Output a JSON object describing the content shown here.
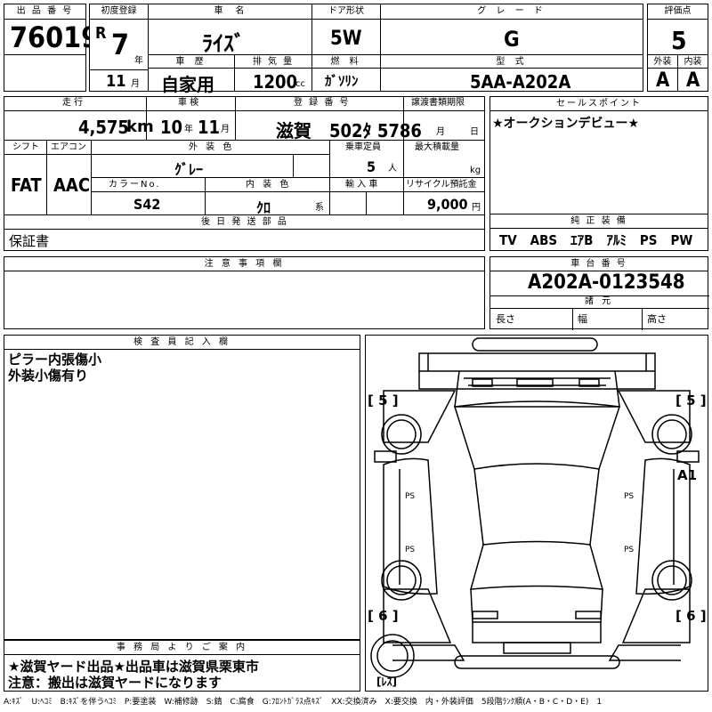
{
  "header": {
    "lot_label": "出 品 番 号",
    "lot": "76019",
    "first_reg_label": "初度登録",
    "era": "R",
    "year": "7",
    "year_unit": "年",
    "month": "11",
    "month_unit": "月",
    "name_label": "車　名",
    "name": "ﾗｲｽﾞ",
    "door_label": "ドア形状",
    "door": "5W",
    "grade_label": "グ レ ー ド",
    "grade": "G",
    "score_label": "評価点",
    "score": "5",
    "history_label": "車 歴",
    "history": "自家用",
    "displacement_label": "排 気 量",
    "displacement": "1200",
    "displacement_unit": "cc",
    "fuel_label": "燃 料",
    "fuel": "ｶﾞｿﾘﾝ",
    "model_label": "型 式",
    "model": "5AA-A202A",
    "ext_label": "外装",
    "ext": "A",
    "int_label": "内装",
    "int": "A"
  },
  "row2": {
    "mileage_label": "走 行",
    "mileage": "4,575",
    "mileage_unit": "km",
    "inspection_label": "車 検",
    "insp_year": "10",
    "insp_year_unit": "年",
    "insp_month": "11",
    "insp_month_unit": "月",
    "reg_no_label": "登 録 番 号",
    "reg_no": "滋賀　502ﾀ 5786",
    "transfer_label": "譲渡書類期限",
    "transfer_month_unit": "月",
    "transfer_day_unit": "日",
    "sales_label": "セールスポイント",
    "sales": "★オークションデビュー★"
  },
  "row3": {
    "shift_label": "シフト",
    "shift": "FAT",
    "ac_label": "エアコン",
    "ac": "AAC",
    "color_label": "外 装 色",
    "color": "ｸﾞﾚｰ",
    "capacity_label": "乗車定員",
    "capacity": "5",
    "capacity_unit": "人",
    "load_label": "最大積載量",
    "load_unit": "kg",
    "color_no_label": "カラーNo.",
    "color_no": "S42",
    "int_color_label": "内 装 色",
    "int_color": "ｸﾛ",
    "int_color_unit": "系",
    "import_label": "輸 入 車",
    "recycle_label": "リサイクル預託金",
    "recycle": "9,000",
    "recycle_unit": "円"
  },
  "parts": {
    "label": "後 日 発 送 部 品",
    "text": "保証書"
  },
  "equipment": {
    "label": "純 正 装 備",
    "text": "TV　ABS　ｴｱB　ｱﾙﾐ　PS　PW"
  },
  "notes": {
    "label": "注 意 事 項 欄"
  },
  "chassis": {
    "label": "車 台 番 号",
    "value": "A202A-0123548",
    "spec_label": "諸 元",
    "length_label": "長さ",
    "width_label": "幅",
    "height_label": "高さ"
  },
  "inspector": {
    "label": "検 査 員 記 入 欄",
    "line1": "ピラー内張傷小",
    "line2": "外装小傷有り"
  },
  "office": {
    "label": "事 務 局 よ り ご 案 内",
    "line1": "★滋賀ヤード出品★出品車は滋賀県栗東市",
    "line2": "注意：搬出は滋賀ヤードになります"
  },
  "diagram": {
    "tread_fl": "[ 5 ]",
    "tread_fr": "[ 5 ]",
    "tread_rl": "[ 6 ]",
    "tread_rr": "[ 6 ]",
    "damage_mark": "A1",
    "tire": "[ﾚｽ]"
  },
  "legend": "A:ｷｽﾞ　U:ﾍｺﾐ　B:ｷｽﾞを伴うﾍｺﾐ　P:要塗装　W:補修跡　S:錆　C:腐食　G:ﾌﾛﾝﾄｶﾞﾗｽ点ｷｽﾞ　XX:交換済み　X:要交換　内・外装評価　5段階ﾗﾝｸ順(A・B・C・D・E)　1"
}
